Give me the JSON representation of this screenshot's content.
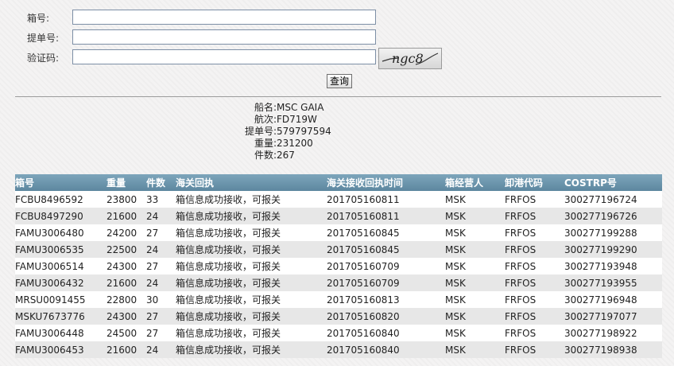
{
  "form": {
    "container_label": "箱号:",
    "bl_label": "提单号:",
    "captcha_label": "验证码:",
    "container_value": "",
    "bl_value": "",
    "captcha_value": "",
    "captcha_text": "ngc8",
    "query_button": "查询"
  },
  "info": {
    "vessel_label": "船名:",
    "vessel": "MSC GAIA",
    "voyage_label": "航次:",
    "voyage": "FD719W",
    "bl_label": "提单号:",
    "bl": "579797594",
    "weight_label": "重量:",
    "weight": "231200",
    "pieces_label": "件数:",
    "pieces": "267"
  },
  "table": {
    "headers": [
      "箱号",
      "重量",
      "件数",
      "海关回执",
      "海关接收回执时间",
      "箱经营人",
      "卸港代码",
      "COSTRP号"
    ],
    "rows": [
      [
        "FCBU8496592",
        "23800",
        "33",
        "箱信息成功接收，可报关",
        "201705160811",
        "MSK",
        "FRFOS",
        "300277196724"
      ],
      [
        "FCBU8497290",
        "21600",
        "24",
        "箱信息成功接收，可报关",
        "201705160811",
        "MSK",
        "FRFOS",
        "300277196726"
      ],
      [
        "FAMU3006480",
        "24200",
        "27",
        "箱信息成功接收，可报关",
        "201705160845",
        "MSK",
        "FRFOS",
        "300277199288"
      ],
      [
        "FAMU3006535",
        "22500",
        "24",
        "箱信息成功接收，可报关",
        "201705160845",
        "MSK",
        "FRFOS",
        "300277199290"
      ],
      [
        "FAMU3006514",
        "24300",
        "27",
        "箱信息成功接收，可报关",
        "201705160709",
        "MSK",
        "FRFOS",
        "300277193948"
      ],
      [
        "FAMU3006432",
        "21600",
        "24",
        "箱信息成功接收，可报关",
        "201705160709",
        "MSK",
        "FRFOS",
        "300277193955"
      ],
      [
        "MRSU0091455",
        "22800",
        "30",
        "箱信息成功接收，可报关",
        "201705160813",
        "MSK",
        "FRFOS",
        "300277196948"
      ],
      [
        "MSKU7673776",
        "24300",
        "27",
        "箱信息成功接收，可报关",
        "201705160820",
        "MSK",
        "FRFOS",
        "300277197077"
      ],
      [
        "FAMU3006448",
        "24500",
        "27",
        "箱信息成功接收，可报关",
        "201705160840",
        "MSK",
        "FRFOS",
        "300277198922"
      ],
      [
        "FAMU3006453",
        "21600",
        "24",
        "箱信息成功接收，可报关",
        "201705160840",
        "MSK",
        "FRFOS",
        "300277198938"
      ]
    ]
  }
}
